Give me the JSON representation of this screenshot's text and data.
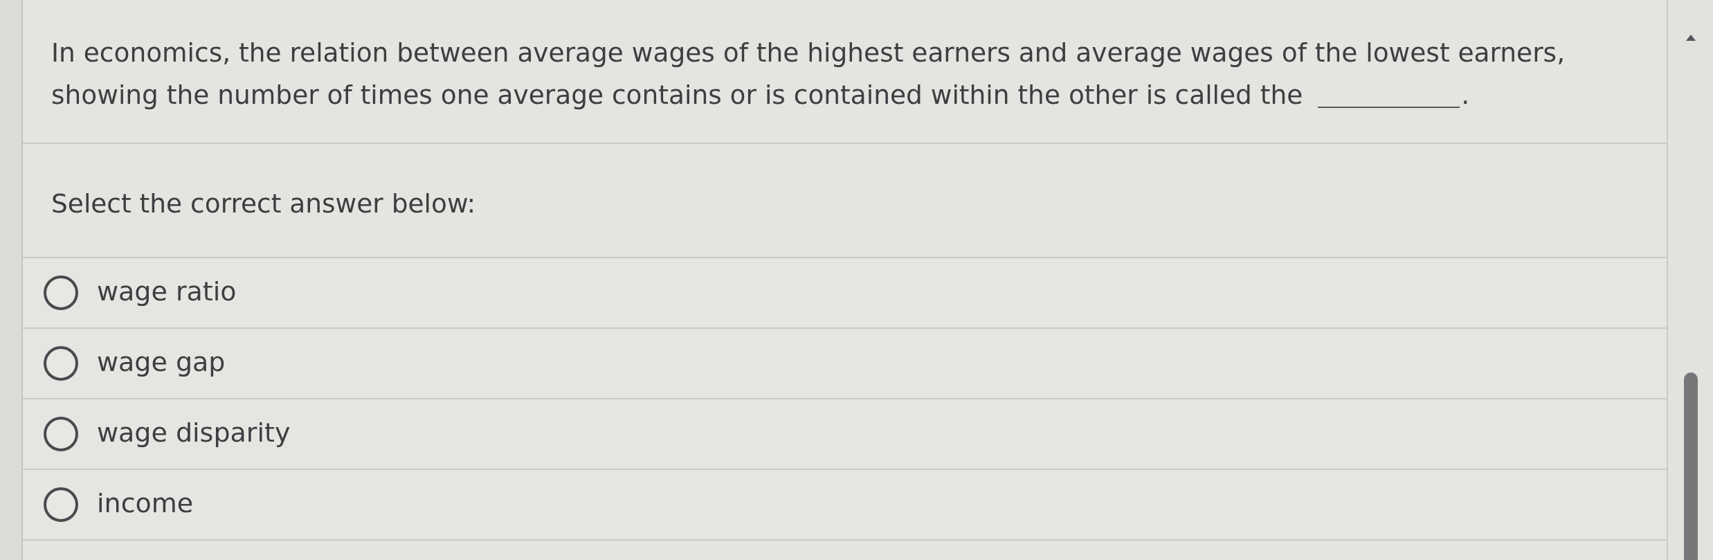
{
  "question": {
    "parts": [
      {
        "kind": "text",
        "text": "In economics, the relation between average wages of the highest earners and average wages of the lowest earners, showing the number of times one average contains or is contained within the other is called the"
      },
      {
        "kind": "blank"
      },
      {
        "kind": "text",
        "text": "."
      }
    ]
  },
  "prompt": "Select the correct answer below:",
  "options": [
    {
      "label": "wage ratio",
      "selected": false
    },
    {
      "label": "wage gap",
      "selected": false
    },
    {
      "label": "wage disparity",
      "selected": false
    },
    {
      "label": "income",
      "selected": false
    }
  ]
}
